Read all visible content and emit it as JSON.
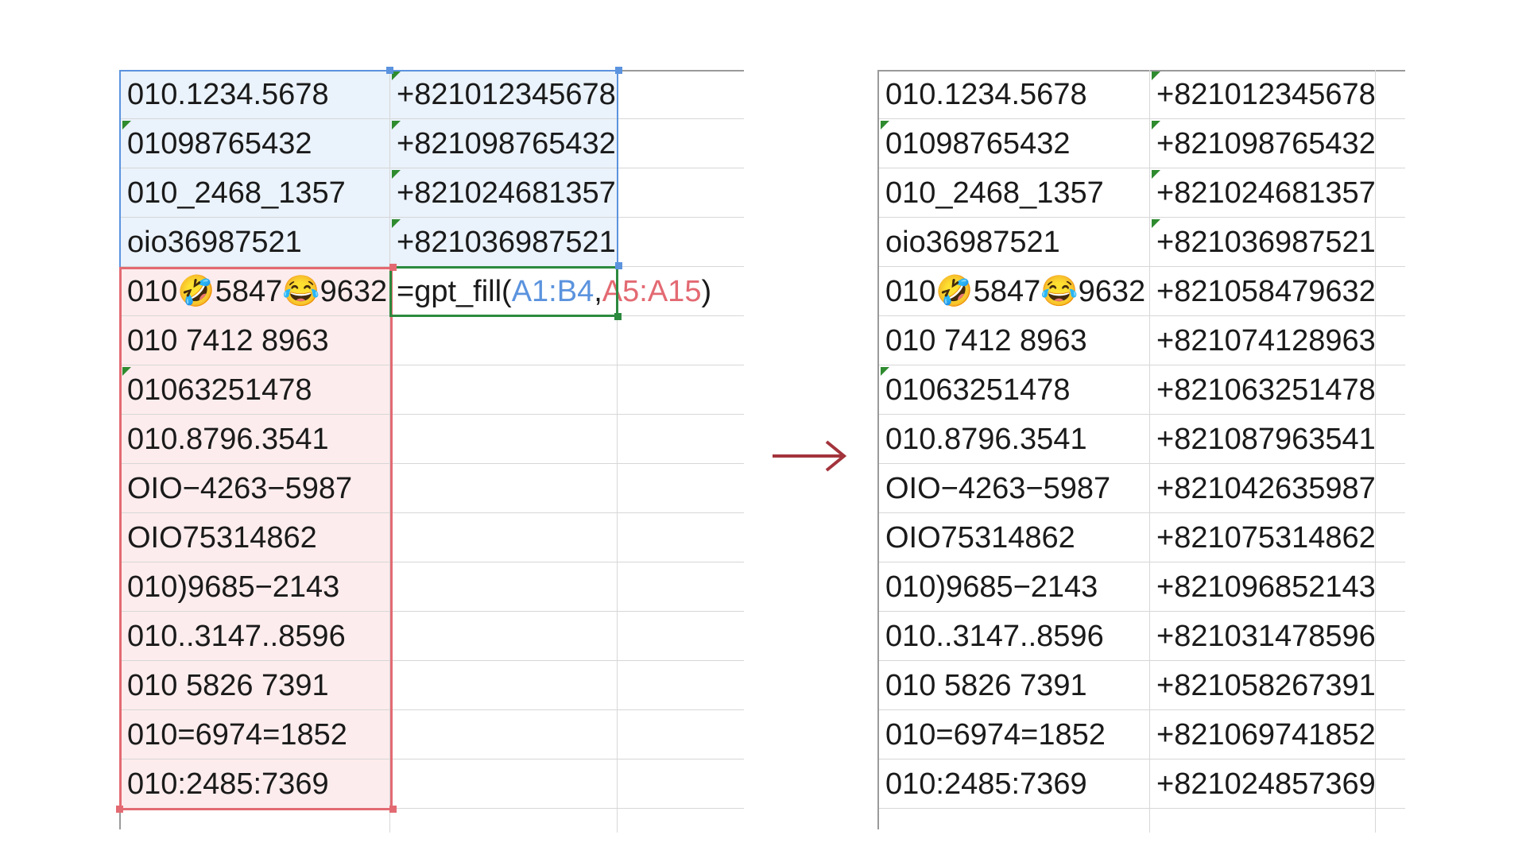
{
  "left_sheet": {
    "rows": [
      {
        "a": "010.1234.5678",
        "b": "+821012345678",
        "a_marker": false,
        "b_marker": true
      },
      {
        "a": "01098765432",
        "b": "+821098765432",
        "a_marker": true,
        "b_marker": true
      },
      {
        "a": "010_2468_1357",
        "b": "+821024681357",
        "a_marker": false,
        "b_marker": true
      },
      {
        "a": "oio36987521",
        "b": "+821036987521",
        "a_marker": false,
        "b_marker": true
      },
      {
        "a": "010🤣5847😂9632",
        "b": "",
        "a_marker": false,
        "b_marker": false
      },
      {
        "a": "010 7412 8963",
        "b": "",
        "a_marker": false,
        "b_marker": false
      },
      {
        "a": "01063251478",
        "b": "",
        "a_marker": true,
        "b_marker": false
      },
      {
        "a": "010.8796.3541",
        "b": "",
        "a_marker": false,
        "b_marker": false
      },
      {
        "a": "OIO−4263−5987",
        "b": "",
        "a_marker": false,
        "b_marker": false
      },
      {
        "a": "OIO75314862",
        "b": "",
        "a_marker": false,
        "b_marker": false
      },
      {
        "a": "010)9685−2143",
        "b": "",
        "a_marker": false,
        "b_marker": false
      },
      {
        "a": "010..3147..8596",
        "b": "",
        "a_marker": false,
        "b_marker": false
      },
      {
        "a": "010 5826 7391",
        "b": "",
        "a_marker": false,
        "b_marker": false
      },
      {
        "a": "010=6974=1852",
        "b": "",
        "a_marker": false,
        "b_marker": false
      },
      {
        "a": "010:2485:7369",
        "b": "",
        "a_marker": false,
        "b_marker": false
      }
    ],
    "formula": {
      "prefix": "=gpt_fill(",
      "ref1": "A1:B4",
      "comma": ",",
      "ref2": "A5:A15",
      "suffix": ")"
    }
  },
  "right_sheet": {
    "rows": [
      {
        "a": "010.1234.5678",
        "b": "+821012345678",
        "a_marker": false,
        "b_marker": true
      },
      {
        "a": "01098765432",
        "b": "+821098765432",
        "a_marker": true,
        "b_marker": true
      },
      {
        "a": "010_2468_1357",
        "b": "+821024681357",
        "a_marker": false,
        "b_marker": true
      },
      {
        "a": "oio36987521",
        "b": "+821036987521",
        "a_marker": false,
        "b_marker": true
      },
      {
        "a": "010🤣5847😂9632",
        "b": "+821058479632",
        "a_marker": false,
        "b_marker": false
      },
      {
        "a": "010 7412 8963",
        "b": "+821074128963",
        "a_marker": false,
        "b_marker": false
      },
      {
        "a": "01063251478",
        "b": "+821063251478",
        "a_marker": true,
        "b_marker": false
      },
      {
        "a": "010.8796.3541",
        "b": "+821087963541",
        "a_marker": false,
        "b_marker": false
      },
      {
        "a": "OIO−4263−5987",
        "b": "+821042635987",
        "a_marker": false,
        "b_marker": false
      },
      {
        "a": "OIO75314862",
        "b": "+821075314862",
        "a_marker": false,
        "b_marker": false
      },
      {
        "a": "010)9685−2143",
        "b": "+821096852143",
        "a_marker": false,
        "b_marker": false
      },
      {
        "a": "010..3147..8596",
        "b": "+821031478596",
        "a_marker": false,
        "b_marker": false
      },
      {
        "a": "010 5826 7391",
        "b": "+821058267391",
        "a_marker": false,
        "b_marker": false
      },
      {
        "a": "010=6974=1852",
        "b": "+821069741852",
        "a_marker": false,
        "b_marker": false
      },
      {
        "a": "010:2485:7369",
        "b": "+821024857369",
        "a_marker": false,
        "b_marker": false
      }
    ]
  },
  "arrow": {
    "icon": "right-arrow-icon",
    "color": "#a3343c"
  },
  "colors": {
    "example_range": "#5b93de",
    "input_range": "#e36a72",
    "active_cell": "#2c8a3f",
    "example_fill": "#eaf2fb",
    "input_fill": "#fdeced",
    "note_marker": "#2e8b2e"
  }
}
